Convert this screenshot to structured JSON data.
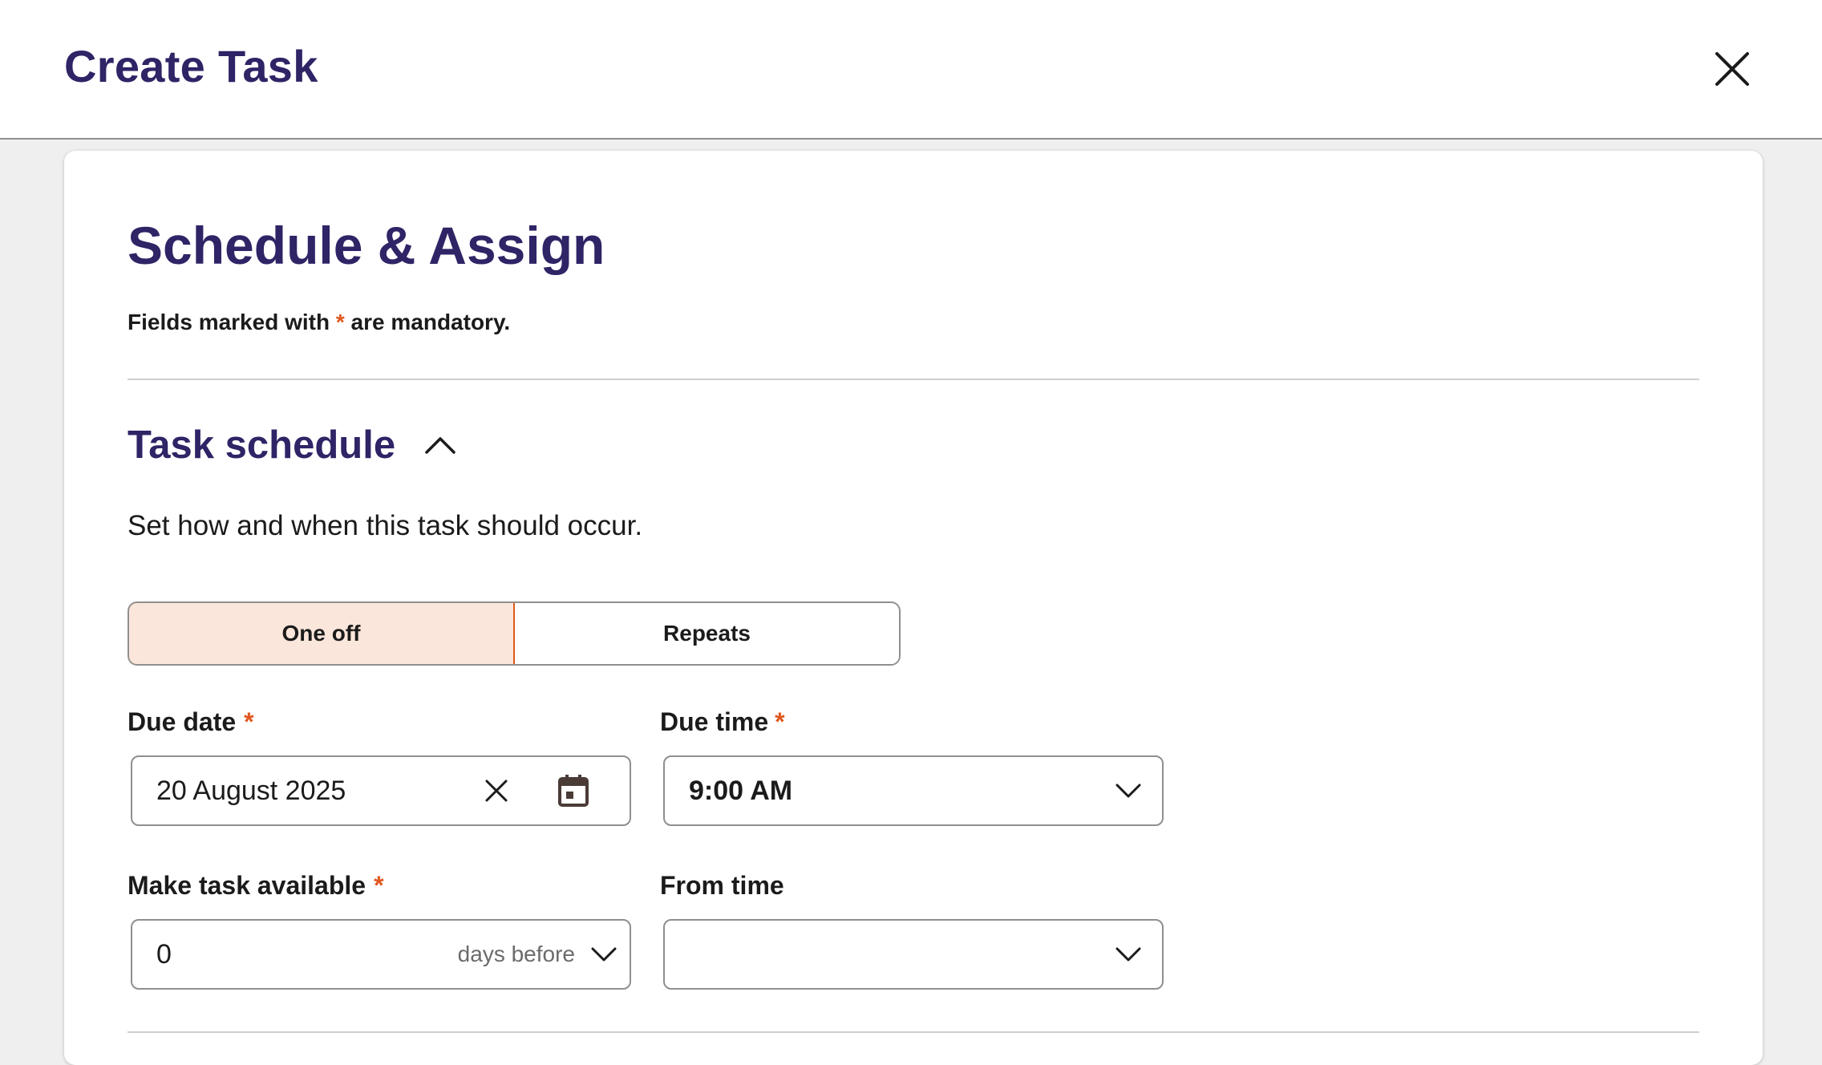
{
  "header": {
    "title": "Create Task"
  },
  "page": {
    "heading": "Schedule & Assign",
    "mandatory_prefix": "Fields marked with ",
    "mandatory_star": "*",
    "mandatory_suffix": " are mandatory."
  },
  "task_schedule": {
    "title": "Task schedule",
    "description": "Set how and when this task should occur.",
    "frequency_options": [
      {
        "label": "One off",
        "selected": true
      },
      {
        "label": "Repeats",
        "selected": false
      }
    ],
    "due_date": {
      "label": "Due date",
      "star": "*",
      "value": "20 August 2025"
    },
    "due_time": {
      "label": "Due time",
      "star": "*",
      "value": "9:00 AM"
    },
    "make_available": {
      "label": "Make task available",
      "star": "*",
      "value": "0",
      "unit": "days before"
    },
    "from_time": {
      "label": "From time",
      "value": ""
    }
  },
  "colors": {
    "heading": "#2e2466",
    "accent": "#e0571f",
    "selected_bg": "#fbe6db",
    "border": "#8f8f8f"
  },
  "icons": [
    "close-icon",
    "chevron-up-icon",
    "clear-icon",
    "calendar-icon",
    "chevron-down-icon"
  ]
}
